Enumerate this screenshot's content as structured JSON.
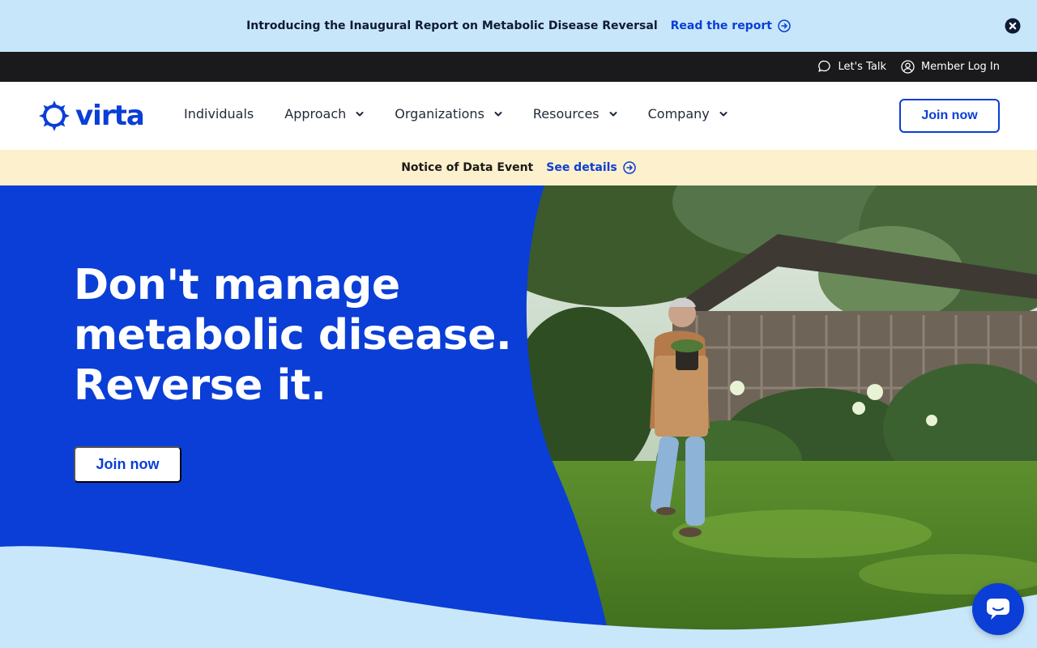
{
  "announcement": {
    "text": "Introducing the Inaugural Report on Metabolic Disease Reversal",
    "link_label": "Read the report",
    "icons": [
      "arrow-circle-icon",
      "close-icon"
    ]
  },
  "utility_bar": {
    "items": [
      {
        "label": "Let's Talk",
        "icon": "chat-bubble-icon"
      },
      {
        "label": "Member Log In",
        "icon": "user-circle-icon"
      }
    ]
  },
  "nav": {
    "logo_text": "virta",
    "items": [
      {
        "label": "Individuals",
        "has_dropdown": false
      },
      {
        "label": "Approach",
        "has_dropdown": true
      },
      {
        "label": "Organizations",
        "has_dropdown": true
      },
      {
        "label": "Resources",
        "has_dropdown": true
      },
      {
        "label": "Company",
        "has_dropdown": true
      }
    ],
    "cta_label": "Join now"
  },
  "notice": {
    "text": "Notice of Data Event",
    "link_label": "See details"
  },
  "hero": {
    "headline_lines": [
      "Don't manage",
      "metabolic disease.",
      "Reverse it."
    ],
    "cta_label": "Join now",
    "image_icon": "photo-gardener"
  },
  "chat_widget": {
    "icon": "chat-icon"
  },
  "colors": {
    "brand_blue": "#0a3ed6",
    "announcement_bg": "#c7e6fa",
    "utility_bg": "#1a1a1c",
    "notice_bg": "#fdf0cc",
    "wave_light": "#c9e7fb"
  }
}
